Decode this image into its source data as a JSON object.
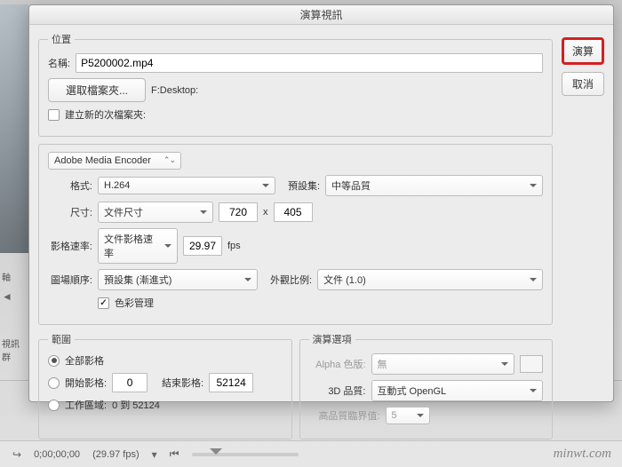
{
  "window": {
    "title": "演算視訊"
  },
  "sideButtons": {
    "render": "演算",
    "cancel": "取消"
  },
  "location": {
    "legend": "位置",
    "nameLabel": "名稱:",
    "nameValue": "P5200002.mp4",
    "chooseFolder": "選取檔案夾...",
    "path": "F:Desktop:",
    "createSub": "建立新的次檔案夾:"
  },
  "encoder": {
    "module": "Adobe Media Encoder",
    "formatLabel": "格式:",
    "formatValue": "H.264",
    "presetLabel": "預設集:",
    "presetValue": "中等品質",
    "sizeLabel": "尺寸:",
    "sizeMode": "文件尺寸",
    "width": "720",
    "by": "x",
    "height": "405",
    "fpsLabel": "影格速率:",
    "fpsMode": "文件影格速率",
    "fpsValue": "29.97",
    "fpsUnit": "fps",
    "fieldLabel": "圖場順序:",
    "fieldValue": "預設集 (漸進式)",
    "aspectLabel": "外觀比例:",
    "aspectValue": "文件 (1.0)",
    "colorMgmt": "色彩管理"
  },
  "range": {
    "legend": "範圍",
    "all": "全部影格",
    "startLabel": "開始影格:",
    "startValue": "0",
    "endLabel": "結束影格:",
    "endValue": "52124",
    "workArea": "工作區域:",
    "workRange": "0 到 52124"
  },
  "options": {
    "legend": "演算選項",
    "alphaLabel": "Alpha 色版:",
    "alphaValue": "無",
    "qualityLabel": "3D 品質:",
    "qualityValue": "互動式 OpenGL",
    "thresholdLabel": "高品質臨界值:",
    "thresholdValue": "5"
  },
  "status": {
    "timecode": "0;00;00;00",
    "fps": "(29.97 fps)"
  },
  "bgSide": {
    "axis": "軸",
    "tri": "◄",
    "group": "視訊群"
  },
  "watermark": "minwt.com"
}
